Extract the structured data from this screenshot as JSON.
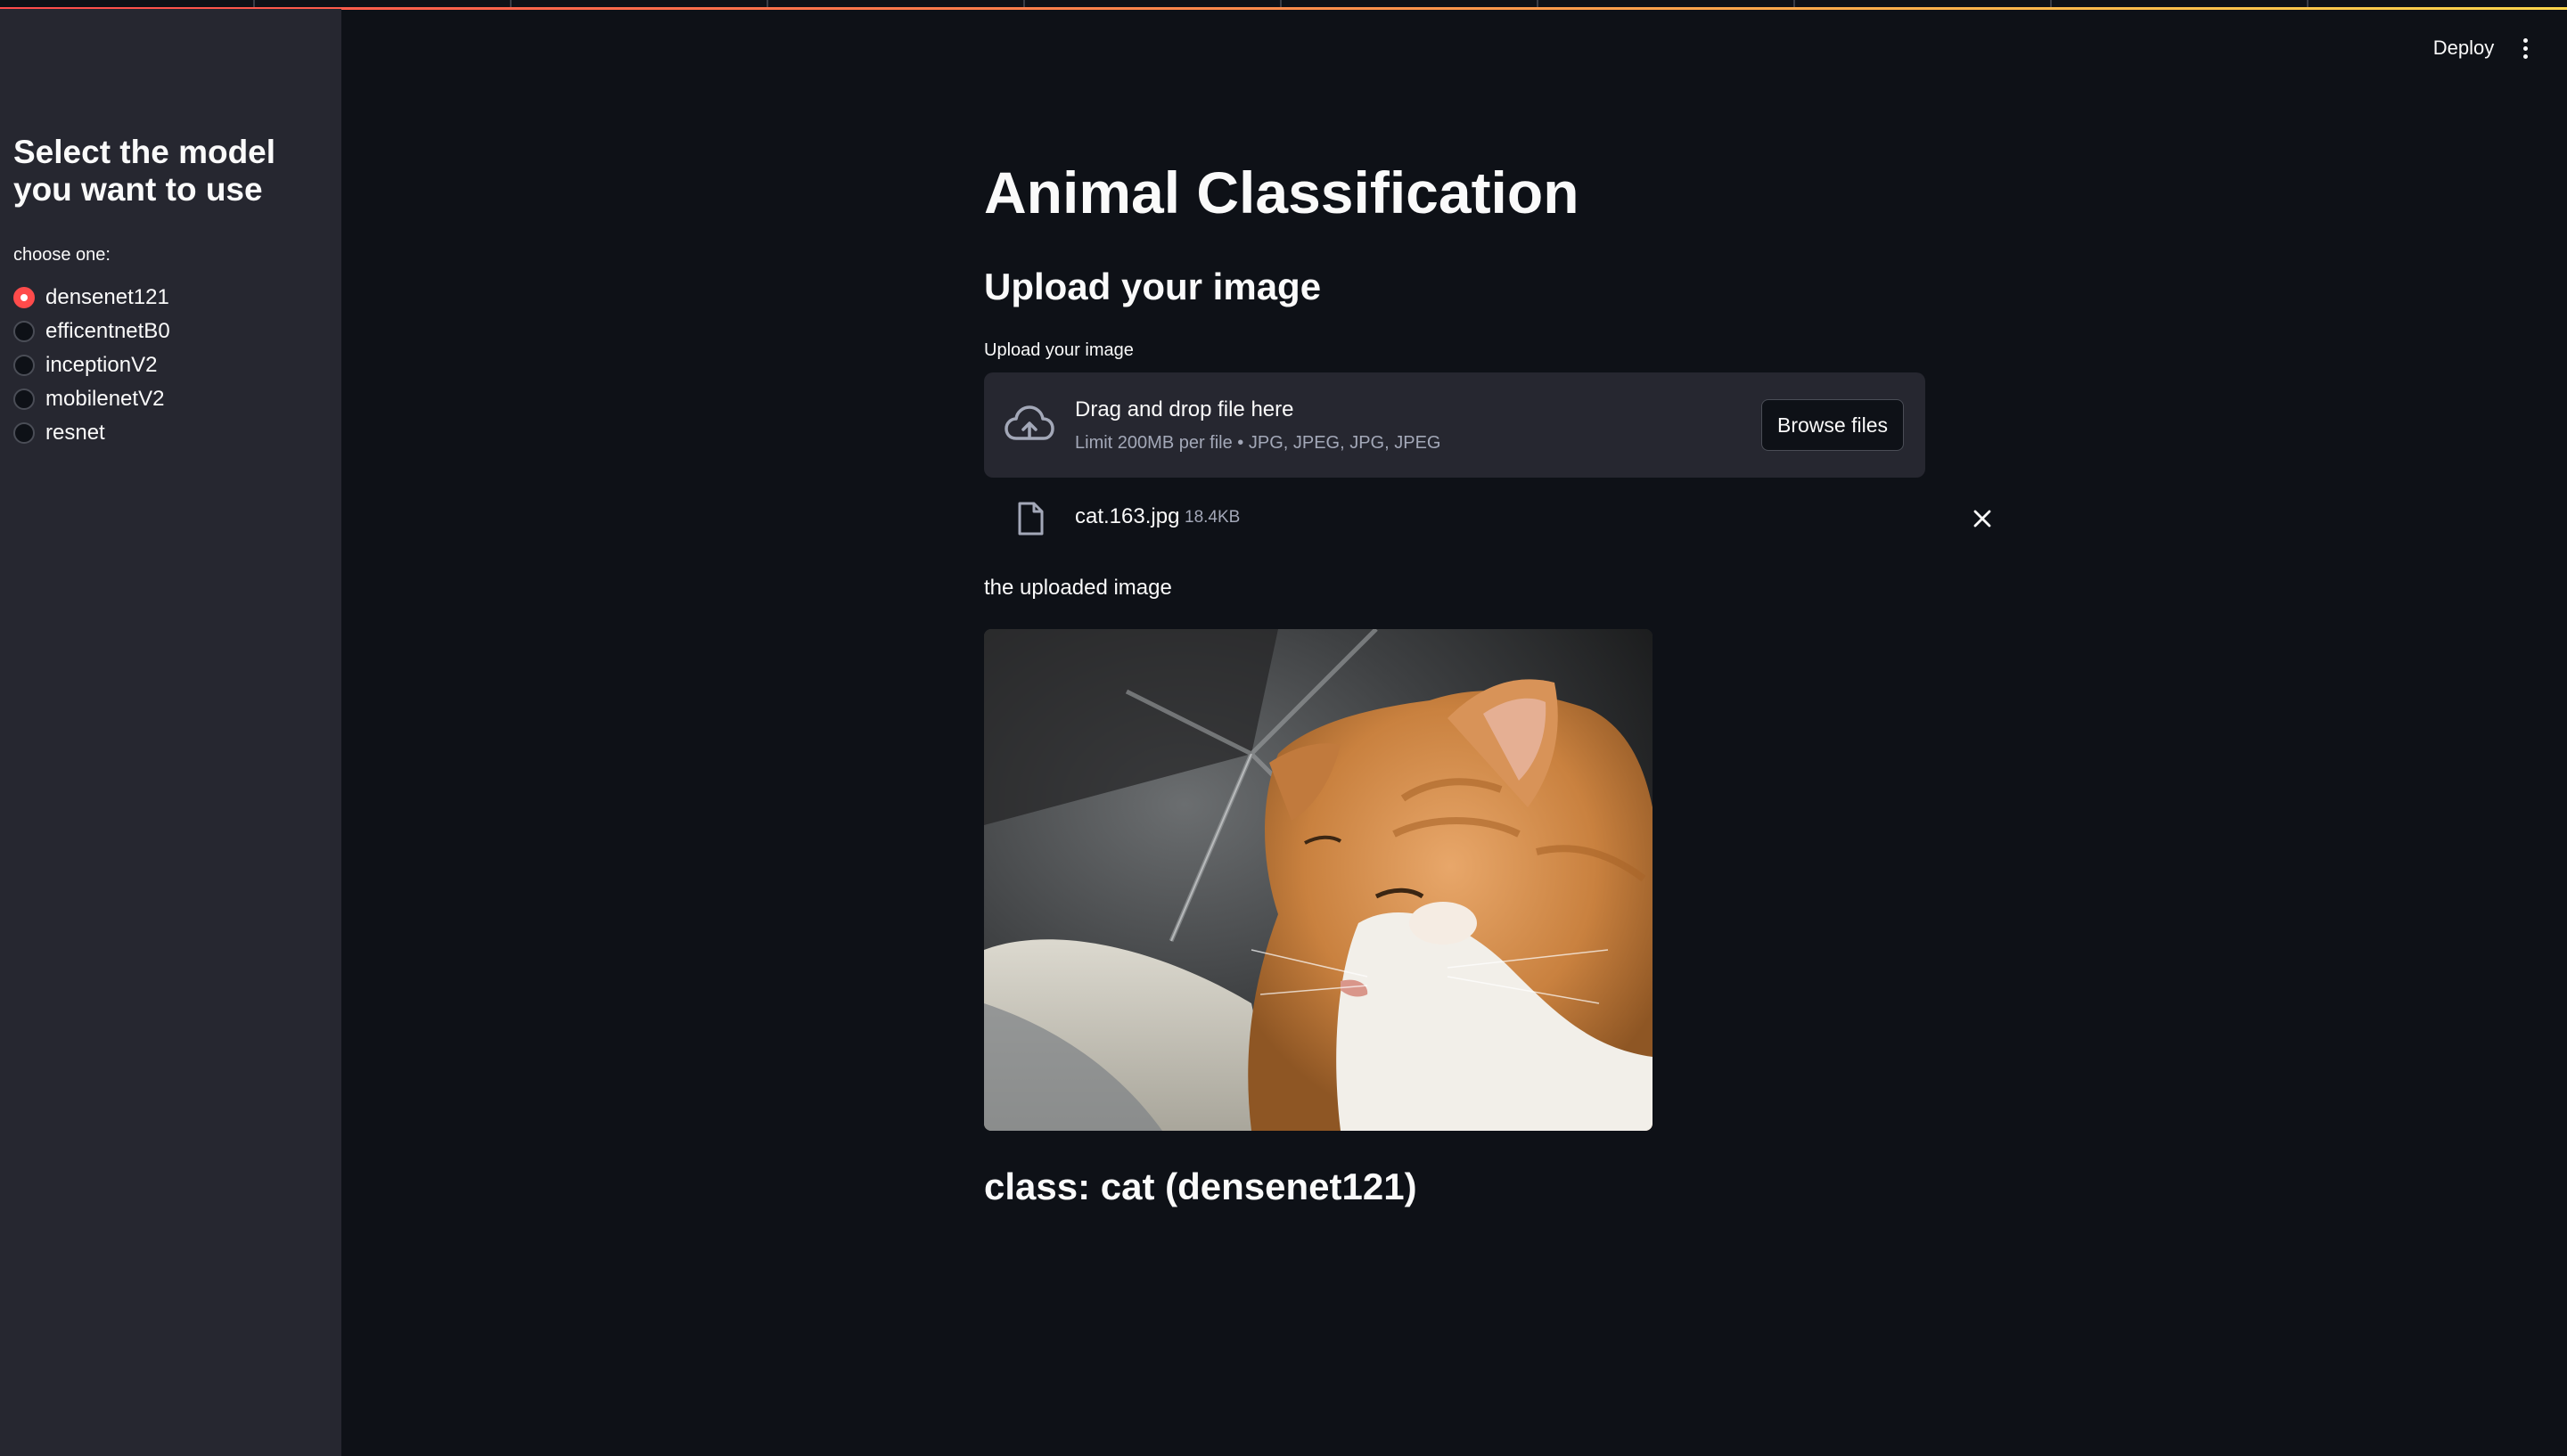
{
  "header": {
    "deploy_label": "Deploy",
    "menu_icon": "kebab-menu-icon"
  },
  "sidebar": {
    "heading": "Select the model you want to use",
    "radio_label": "choose one:",
    "options": [
      {
        "label": "densenet121",
        "selected": true
      },
      {
        "label": "efficentnetB0",
        "selected": false
      },
      {
        "label": "inceptionV2",
        "selected": false
      },
      {
        "label": "mobilenetV2",
        "selected": false
      },
      {
        "label": "resnet",
        "selected": false
      }
    ]
  },
  "main": {
    "title": "Animal Classification",
    "subtitle": "Upload your image",
    "uploader": {
      "label": "Upload your image",
      "drop_text": "Drag and drop file here",
      "limit_text": "Limit 200MB per file • JPG, JPEG, JPG, JPEG",
      "browse_label": "Browse files",
      "cloud_icon": "cloud-upload-icon"
    },
    "file": {
      "name": "cat.163.jpg",
      "size": "18.4KB",
      "file_icon": "file-icon",
      "remove_icon": "close-icon"
    },
    "image_caption": "the uploaded image",
    "result": "class: cat (densenet121)"
  },
  "colors": {
    "background": "#0e1117",
    "sidebar": "#262730",
    "accent": "#ff4b4b",
    "muted_text": "#a3a8b8"
  }
}
